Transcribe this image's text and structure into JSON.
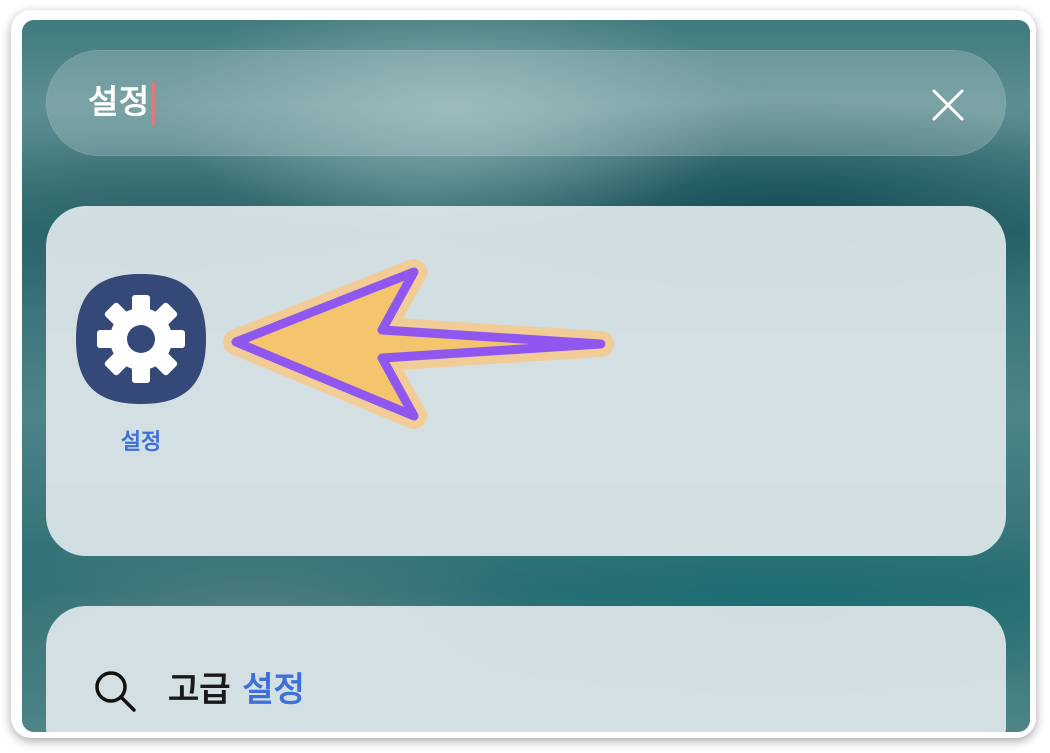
{
  "search": {
    "query": "설정"
  },
  "apps": [
    {
      "label": "설정",
      "icon": "settings-gear-icon"
    }
  ],
  "suggestions": [
    {
      "prefix": "고급 ",
      "match": "설정"
    }
  ],
  "colors": {
    "accent_blue": "#3f6fd8",
    "icon_bg": "#344977",
    "arrow_fill": "#f5c56d",
    "arrow_outline": "#8f57f0",
    "cursor": "#e2787a"
  },
  "icons": {
    "clear": "close-icon",
    "search": "search-icon",
    "annotation": "pointing-arrow"
  }
}
